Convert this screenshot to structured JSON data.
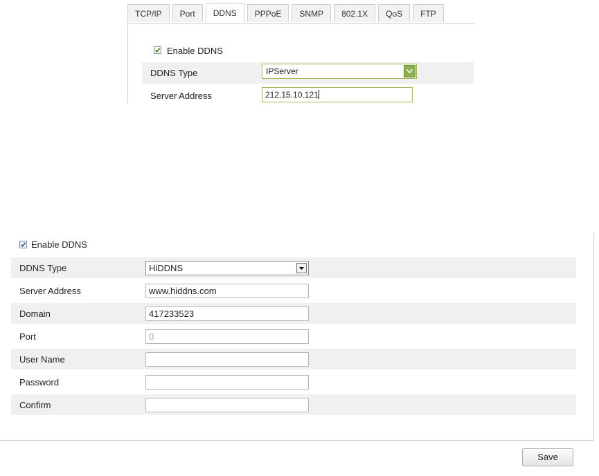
{
  "top": {
    "tabs": [
      "TCP/IP",
      "Port",
      "DDNS",
      "PPPoE",
      "SNMP",
      "802.1X",
      "QoS",
      "FTP"
    ],
    "active_tab": "DDNS",
    "enable_ddns": {
      "label": "Enable DDNS",
      "checked": true
    },
    "ddns_type": {
      "label": "DDNS Type",
      "value": "IPServer"
    },
    "server_address": {
      "label": "Server Address",
      "value": "212.15.10.121"
    }
  },
  "bottom": {
    "enable_ddns": {
      "label": "Enable DDNS",
      "checked": true
    },
    "ddns_type": {
      "label": "DDNS Type",
      "value": "HiDDNS"
    },
    "server_address": {
      "label": "Server Address",
      "value": "www.hiddns.com"
    },
    "domain": {
      "label": "Domain",
      "value": "417233523"
    },
    "port": {
      "label": "Port",
      "value": "0"
    },
    "user_name": {
      "label": "User Name",
      "value": ""
    },
    "password": {
      "label": "Password",
      "value": ""
    },
    "confirm": {
      "label": "Confirm",
      "value": ""
    },
    "save_label": "Save"
  },
  "colors": {
    "top_accent_green": "#8cb050",
    "row_shade": "#f0f0f0",
    "border_gray": "#cfcfcf"
  }
}
